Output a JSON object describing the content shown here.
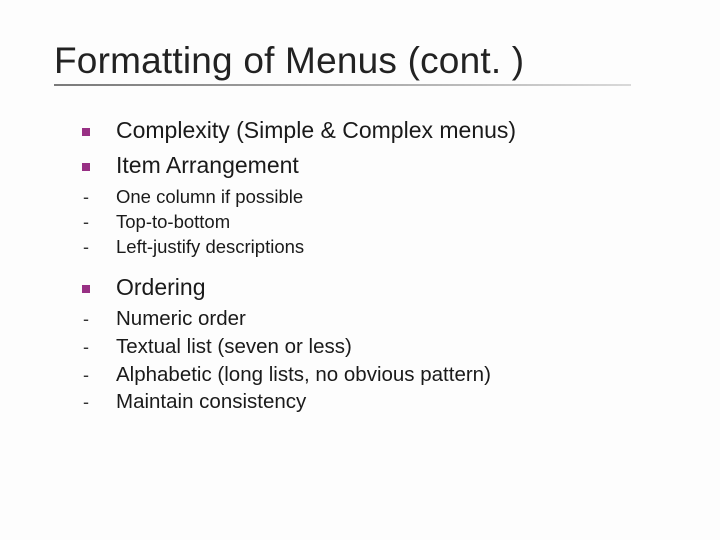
{
  "title": "Formatting of Menus (cont. )",
  "items": [
    {
      "level": 1,
      "text": "Complexity (Simple & Complex menus)"
    },
    {
      "level": 1,
      "text": "Item Arrangement"
    },
    {
      "level": 2,
      "text": "One column if possible"
    },
    {
      "level": 2,
      "text": "Top-to-bottom"
    },
    {
      "level": 2,
      "text": "Left-justify descriptions"
    },
    {
      "level": 1,
      "text": "Ordering"
    },
    {
      "level": 2,
      "text": "Numeric order"
    },
    {
      "level": 2,
      "text": "Textual list (seven or less)"
    },
    {
      "level": 2,
      "text": "Alphabetic (long lists, no obvious pattern)"
    },
    {
      "level": 2,
      "text": "Maintain consistency"
    }
  ]
}
